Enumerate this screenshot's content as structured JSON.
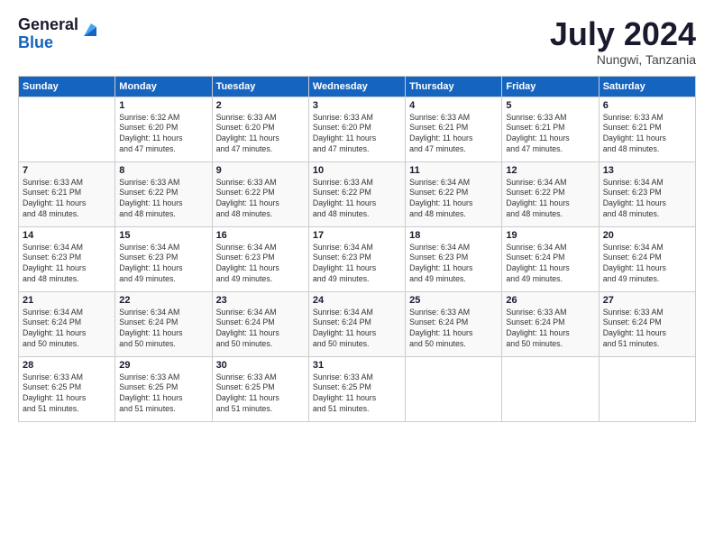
{
  "header": {
    "logo_general": "General",
    "logo_blue": "Blue",
    "month_year": "July 2024",
    "location": "Nungwi, Tanzania"
  },
  "days_of_week": [
    "Sunday",
    "Monday",
    "Tuesday",
    "Wednesday",
    "Thursday",
    "Friday",
    "Saturday"
  ],
  "weeks": [
    [
      {
        "day": "",
        "info": ""
      },
      {
        "day": "1",
        "info": "Sunrise: 6:32 AM\nSunset: 6:20 PM\nDaylight: 11 hours\nand 47 minutes."
      },
      {
        "day": "2",
        "info": "Sunrise: 6:33 AM\nSunset: 6:20 PM\nDaylight: 11 hours\nand 47 minutes."
      },
      {
        "day": "3",
        "info": "Sunrise: 6:33 AM\nSunset: 6:20 PM\nDaylight: 11 hours\nand 47 minutes."
      },
      {
        "day": "4",
        "info": "Sunrise: 6:33 AM\nSunset: 6:21 PM\nDaylight: 11 hours\nand 47 minutes."
      },
      {
        "day": "5",
        "info": "Sunrise: 6:33 AM\nSunset: 6:21 PM\nDaylight: 11 hours\nand 47 minutes."
      },
      {
        "day": "6",
        "info": "Sunrise: 6:33 AM\nSunset: 6:21 PM\nDaylight: 11 hours\nand 48 minutes."
      }
    ],
    [
      {
        "day": "7",
        "info": "Sunrise: 6:33 AM\nSunset: 6:21 PM\nDaylight: 11 hours\nand 48 minutes."
      },
      {
        "day": "8",
        "info": "Sunrise: 6:33 AM\nSunset: 6:22 PM\nDaylight: 11 hours\nand 48 minutes."
      },
      {
        "day": "9",
        "info": "Sunrise: 6:33 AM\nSunset: 6:22 PM\nDaylight: 11 hours\nand 48 minutes."
      },
      {
        "day": "10",
        "info": "Sunrise: 6:33 AM\nSunset: 6:22 PM\nDaylight: 11 hours\nand 48 minutes."
      },
      {
        "day": "11",
        "info": "Sunrise: 6:34 AM\nSunset: 6:22 PM\nDaylight: 11 hours\nand 48 minutes."
      },
      {
        "day": "12",
        "info": "Sunrise: 6:34 AM\nSunset: 6:22 PM\nDaylight: 11 hours\nand 48 minutes."
      },
      {
        "day": "13",
        "info": "Sunrise: 6:34 AM\nSunset: 6:23 PM\nDaylight: 11 hours\nand 48 minutes."
      }
    ],
    [
      {
        "day": "14",
        "info": "Sunrise: 6:34 AM\nSunset: 6:23 PM\nDaylight: 11 hours\nand 48 minutes."
      },
      {
        "day": "15",
        "info": "Sunrise: 6:34 AM\nSunset: 6:23 PM\nDaylight: 11 hours\nand 49 minutes."
      },
      {
        "day": "16",
        "info": "Sunrise: 6:34 AM\nSunset: 6:23 PM\nDaylight: 11 hours\nand 49 minutes."
      },
      {
        "day": "17",
        "info": "Sunrise: 6:34 AM\nSunset: 6:23 PM\nDaylight: 11 hours\nand 49 minutes."
      },
      {
        "day": "18",
        "info": "Sunrise: 6:34 AM\nSunset: 6:23 PM\nDaylight: 11 hours\nand 49 minutes."
      },
      {
        "day": "19",
        "info": "Sunrise: 6:34 AM\nSunset: 6:24 PM\nDaylight: 11 hours\nand 49 minutes."
      },
      {
        "day": "20",
        "info": "Sunrise: 6:34 AM\nSunset: 6:24 PM\nDaylight: 11 hours\nand 49 minutes."
      }
    ],
    [
      {
        "day": "21",
        "info": "Sunrise: 6:34 AM\nSunset: 6:24 PM\nDaylight: 11 hours\nand 50 minutes."
      },
      {
        "day": "22",
        "info": "Sunrise: 6:34 AM\nSunset: 6:24 PM\nDaylight: 11 hours\nand 50 minutes."
      },
      {
        "day": "23",
        "info": "Sunrise: 6:34 AM\nSunset: 6:24 PM\nDaylight: 11 hours\nand 50 minutes."
      },
      {
        "day": "24",
        "info": "Sunrise: 6:34 AM\nSunset: 6:24 PM\nDaylight: 11 hours\nand 50 minutes."
      },
      {
        "day": "25",
        "info": "Sunrise: 6:33 AM\nSunset: 6:24 PM\nDaylight: 11 hours\nand 50 minutes."
      },
      {
        "day": "26",
        "info": "Sunrise: 6:33 AM\nSunset: 6:24 PM\nDaylight: 11 hours\nand 50 minutes."
      },
      {
        "day": "27",
        "info": "Sunrise: 6:33 AM\nSunset: 6:24 PM\nDaylight: 11 hours\nand 51 minutes."
      }
    ],
    [
      {
        "day": "28",
        "info": "Sunrise: 6:33 AM\nSunset: 6:25 PM\nDaylight: 11 hours\nand 51 minutes."
      },
      {
        "day": "29",
        "info": "Sunrise: 6:33 AM\nSunset: 6:25 PM\nDaylight: 11 hours\nand 51 minutes."
      },
      {
        "day": "30",
        "info": "Sunrise: 6:33 AM\nSunset: 6:25 PM\nDaylight: 11 hours\nand 51 minutes."
      },
      {
        "day": "31",
        "info": "Sunrise: 6:33 AM\nSunset: 6:25 PM\nDaylight: 11 hours\nand 51 minutes."
      },
      {
        "day": "",
        "info": ""
      },
      {
        "day": "",
        "info": ""
      },
      {
        "day": "",
        "info": ""
      }
    ]
  ]
}
